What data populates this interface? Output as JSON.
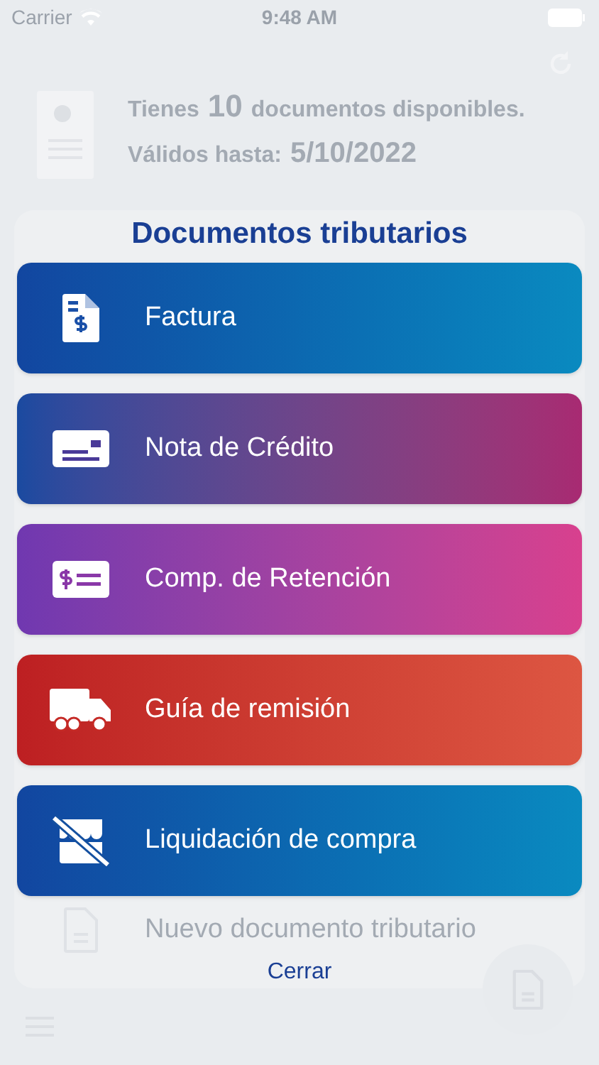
{
  "status_bar": {
    "carrier": "Carrier",
    "time": "9:48 AM"
  },
  "header": {
    "line_1_prefix": "Tienes",
    "count": "10",
    "line_1_suffix": "documentos disponibles.",
    "line_2_prefix": "Válidos hasta:",
    "date": "5/10/2022"
  },
  "sheet": {
    "title": "Documentos tributarios",
    "options": [
      {
        "kind": "invoice",
        "label": "Factura"
      },
      {
        "kind": "credit",
        "label": "Nota de Crédito"
      },
      {
        "kind": "retention",
        "label": "Comp. de Retención"
      },
      {
        "kind": "shipping",
        "label": "Guía de remisión"
      },
      {
        "kind": "purchase",
        "label": "Liquidación de compra"
      }
    ],
    "background_item": "Nuevo documento tributario",
    "close": "Cerrar"
  }
}
